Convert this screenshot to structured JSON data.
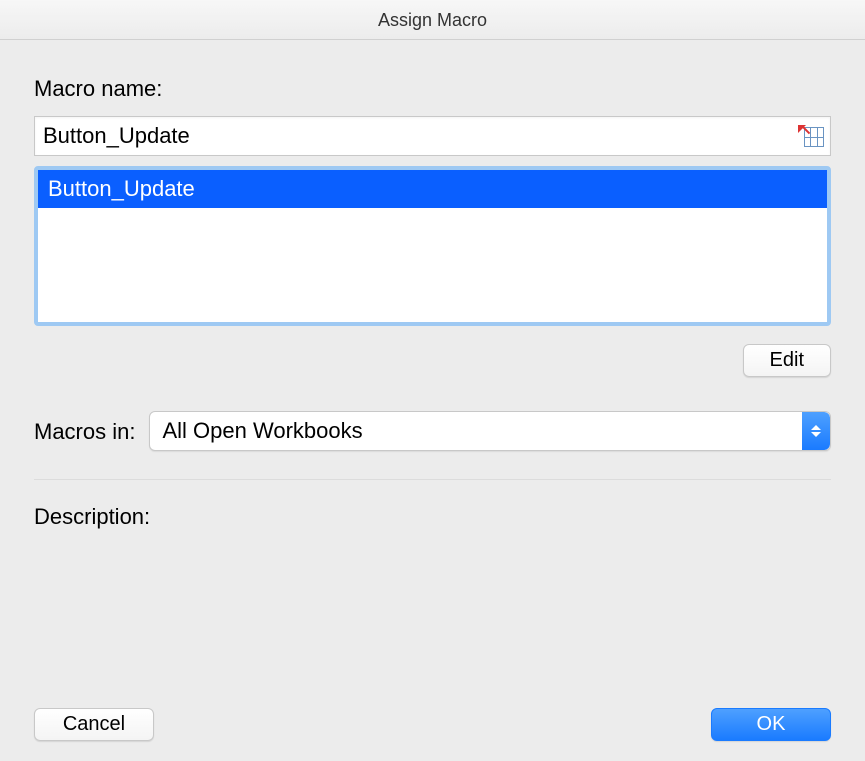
{
  "title": "Assign Macro",
  "labels": {
    "macro_name": "Macro name:",
    "macros_in": "Macros in:",
    "description": "Description:"
  },
  "macro_name_value": "Button_Update",
  "macro_list": [
    {
      "name": "Button_Update",
      "selected": true
    }
  ],
  "buttons": {
    "edit": "Edit",
    "cancel": "Cancel",
    "ok": "OK"
  },
  "macros_in_value": "All Open Workbooks",
  "description_text": ""
}
